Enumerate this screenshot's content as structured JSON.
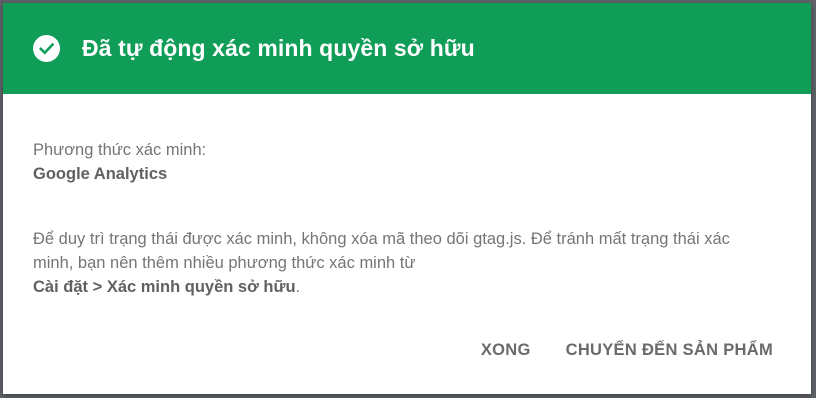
{
  "dialog": {
    "title": "Đã tự động xác minh quyền sở hữu",
    "icon": "check-circle-icon",
    "colors": {
      "header": "#0f9d58",
      "text": "#757575",
      "button": "#6a6a6a"
    },
    "method_label": "Phương thức xác minh:",
    "method_value": "Google Analytics",
    "note_text": "Để duy trì trạng thái được xác minh, không xóa mã theo dõi gtag.js. Để tránh mất trạng thái xác minh, bạn nên thêm nhiều phương thức xác minh từ",
    "note_link": "Cài đặt > Xác minh quyền sở hữu",
    "note_end": ".",
    "buttons": {
      "done": "XONG",
      "go_to_property": "CHUYỂN ĐẾN SẢN PHẨM"
    }
  }
}
